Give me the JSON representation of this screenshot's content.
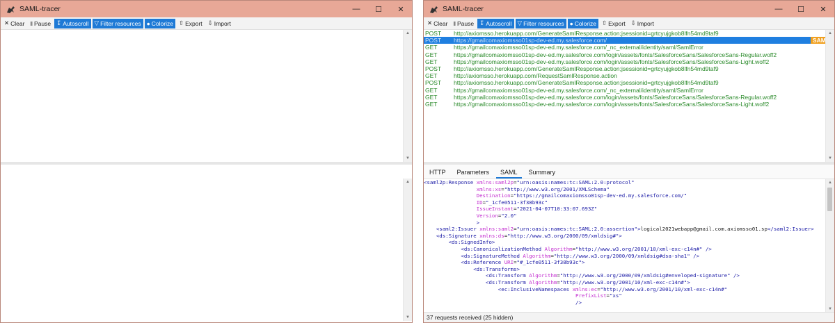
{
  "app": {
    "title": "SAML-tracer"
  },
  "toolbar": {
    "clear": "Clear",
    "pause": "Pause",
    "autoscroll": "Autoscroll",
    "filter": "Filter resources",
    "colorize": "Colorize",
    "export": "Export",
    "import": "Import"
  },
  "requests": [
    {
      "method": "POST",
      "url": "http://axiomsso.herokuapp.com/GenerateSamlResponse.action;jsessionid=grtcyujgkob8lfn54md9taf9"
    },
    {
      "method": "POST",
      "url": "https://gmailcomaxiomsso01sp-dev-ed.my.salesforce.com/",
      "badge": "SAML"
    },
    {
      "method": "GET",
      "url": "https://gmailcomaxiomsso01sp-dev-ed.my.salesforce.com/_nc_external/identity/saml/SamlError"
    },
    {
      "method": "GET",
      "url": "https://gmailcomaxiomsso01sp-dev-ed.my.salesforce.com/login/assets/fonts/SalesforceSans/SalesforceSans-Regular.woff2"
    },
    {
      "method": "GET",
      "url": "https://gmailcomaxiomsso01sp-dev-ed.my.salesforce.com/login/assets/fonts/SalesforceSans/SalesforceSans-Light.woff2"
    },
    {
      "method": "POST",
      "url": "http://axiomsso.herokuapp.com/GenerateSamlResponse.action;jsessionid=grtcyujgkob8lfn54md9taf9"
    },
    {
      "method": "GET",
      "url": "http://axiomsso.herokuapp.com/RequestSamlResponse.action"
    },
    {
      "method": "POST",
      "url": "http://axiomsso.herokuapp.com/GenerateSamlResponse.action;jsessionid=grtcyujgkob8lfn54md9taf9"
    },
    {
      "method": "GET",
      "url": "https://gmailcomaxiomsso01sp-dev-ed.my.salesforce.com/_nc_external/identity/saml/SamlError"
    },
    {
      "method": "GET",
      "url": "https://gmailcomaxiomsso01sp-dev-ed.my.salesforce.com/login/assets/fonts/SalesforceSans/SalesforceSans-Regular.woff2"
    },
    {
      "method": "GET",
      "url": "https://gmailcomaxiomsso01sp-dev-ed.my.salesforce.com/login/assets/fonts/SalesforceSans/SalesforceSans-Light.woff2"
    }
  ],
  "tabs": [
    "HTTP",
    "Parameters",
    "SAML",
    "Summary"
  ],
  "active_tab": "SAML",
  "xml_lines": [
    [
      {
        "c": "tg",
        "t": "<saml2p:Response "
      },
      {
        "c": "at",
        "t": "xmlns:saml2p"
      },
      {
        "c": "tx",
        "t": "="
      },
      {
        "c": "vl",
        "t": "\"urn:oasis:names:tc:SAML:2.0:protocol\""
      }
    ],
    [
      {
        "c": "tx",
        "t": "                 "
      },
      {
        "c": "at",
        "t": "xmlns:xs"
      },
      {
        "c": "tx",
        "t": "="
      },
      {
        "c": "vl",
        "t": "\"http://www.w3.org/2001/XMLSchema\""
      }
    ],
    [
      {
        "c": "tx",
        "t": "                 "
      },
      {
        "c": "at",
        "t": "Destination"
      },
      {
        "c": "tx",
        "t": "="
      },
      {
        "c": "vl",
        "t": "\"https://gmailcomaxiomsso01sp-dev-ed.my.salesforce.com/\""
      }
    ],
    [
      {
        "c": "tx",
        "t": "                 "
      },
      {
        "c": "at",
        "t": "ID"
      },
      {
        "c": "tx",
        "t": "="
      },
      {
        "c": "vl",
        "t": "\"_1cfe0511-3f38b93c\""
      }
    ],
    [
      {
        "c": "tx",
        "t": "                 "
      },
      {
        "c": "at",
        "t": "IssueInstant"
      },
      {
        "c": "tx",
        "t": "="
      },
      {
        "c": "vl",
        "t": "\"2021-04-07T10:33:07.693Z\""
      }
    ],
    [
      {
        "c": "tx",
        "t": "                 "
      },
      {
        "c": "at",
        "t": "Version"
      },
      {
        "c": "tx",
        "t": "="
      },
      {
        "c": "vl",
        "t": "\"2.0\""
      }
    ],
    [
      {
        "c": "tx",
        "t": "                 "
      },
      {
        "c": "tg",
        "t": ">"
      }
    ],
    [
      {
        "c": "tx",
        "t": "    "
      },
      {
        "c": "tg",
        "t": "<saml2:Issuer "
      },
      {
        "c": "at",
        "t": "xmlns:saml2"
      },
      {
        "c": "tx",
        "t": "="
      },
      {
        "c": "vl",
        "t": "\"urn:oasis:names:tc:SAML:2.0:assertion\""
      },
      {
        "c": "tg",
        "t": ">"
      },
      {
        "c": "tx",
        "t": "logical2021webapp@gmail.com.axiomsso01.sp"
      },
      {
        "c": "tg",
        "t": "</saml2:Issuer>"
      }
    ],
    [
      {
        "c": "tx",
        "t": "    "
      },
      {
        "c": "tg",
        "t": "<ds:Signature "
      },
      {
        "c": "at",
        "t": "xmlns:ds"
      },
      {
        "c": "tx",
        "t": "="
      },
      {
        "c": "vl",
        "t": "\"http://www.w3.org/2000/09/xmldsig#\""
      },
      {
        "c": "tg",
        "t": ">"
      }
    ],
    [
      {
        "c": "tx",
        "t": "        "
      },
      {
        "c": "tg",
        "t": "<ds:SignedInfo>"
      }
    ],
    [
      {
        "c": "tx",
        "t": "            "
      },
      {
        "c": "tg",
        "t": "<ds:CanonicalizationMethod "
      },
      {
        "c": "at",
        "t": "Algorithm"
      },
      {
        "c": "tx",
        "t": "="
      },
      {
        "c": "vl",
        "t": "\"http://www.w3.org/2001/10/xml-exc-c14n#\""
      },
      {
        "c": "tg",
        "t": " />"
      }
    ],
    [
      {
        "c": "tx",
        "t": "            "
      },
      {
        "c": "tg",
        "t": "<ds:SignatureMethod "
      },
      {
        "c": "at",
        "t": "Algorithm"
      },
      {
        "c": "tx",
        "t": "="
      },
      {
        "c": "vl",
        "t": "\"http://www.w3.org/2000/09/xmldsig#dsa-sha1\""
      },
      {
        "c": "tg",
        "t": " />"
      }
    ],
    [
      {
        "c": "tx",
        "t": "            "
      },
      {
        "c": "tg",
        "t": "<ds:Reference "
      },
      {
        "c": "at",
        "t": "URI"
      },
      {
        "c": "tx",
        "t": "="
      },
      {
        "c": "vl",
        "t": "\"#_1cfe0511-3f38b93c\""
      },
      {
        "c": "tg",
        "t": ">"
      }
    ],
    [
      {
        "c": "tx",
        "t": "                "
      },
      {
        "c": "tg",
        "t": "<ds:Transforms>"
      }
    ],
    [
      {
        "c": "tx",
        "t": "                    "
      },
      {
        "c": "tg",
        "t": "<ds:Transform "
      },
      {
        "c": "at",
        "t": "Algorithm"
      },
      {
        "c": "tx",
        "t": "="
      },
      {
        "c": "vl",
        "t": "\"http://www.w3.org/2000/09/xmldsig#enveloped-signature\""
      },
      {
        "c": "tg",
        "t": " />"
      }
    ],
    [
      {
        "c": "tx",
        "t": "                    "
      },
      {
        "c": "tg",
        "t": "<ds:Transform "
      },
      {
        "c": "at",
        "t": "Algorithm"
      },
      {
        "c": "tx",
        "t": "="
      },
      {
        "c": "vl",
        "t": "\"http://www.w3.org/2001/10/xml-exc-c14n#\""
      },
      {
        "c": "tg",
        "t": ">"
      }
    ],
    [
      {
        "c": "tx",
        "t": "                        "
      },
      {
        "c": "tg",
        "t": "<ec:InclusiveNamespaces "
      },
      {
        "c": "at",
        "t": "xmlns:ec"
      },
      {
        "c": "tx",
        "t": "="
      },
      {
        "c": "vl",
        "t": "\"http://www.w3.org/2001/10/xml-exc-c14n#\""
      }
    ],
    [
      {
        "c": "tx",
        "t": "                                                 "
      },
      {
        "c": "at",
        "t": "PrefixList"
      },
      {
        "c": "tx",
        "t": "="
      },
      {
        "c": "vl",
        "t": "\"xs\""
      }
    ],
    [
      {
        "c": "tx",
        "t": "                                                 "
      },
      {
        "c": "tg",
        "t": "/>"
      }
    ]
  ],
  "status": "37 requests received (25 hidden)",
  "colors": {
    "titlebar": "#e8a897",
    "accent": "#1e7ad6",
    "request_text": "#2a8a2a",
    "saml_badge": "#f0a020"
  }
}
